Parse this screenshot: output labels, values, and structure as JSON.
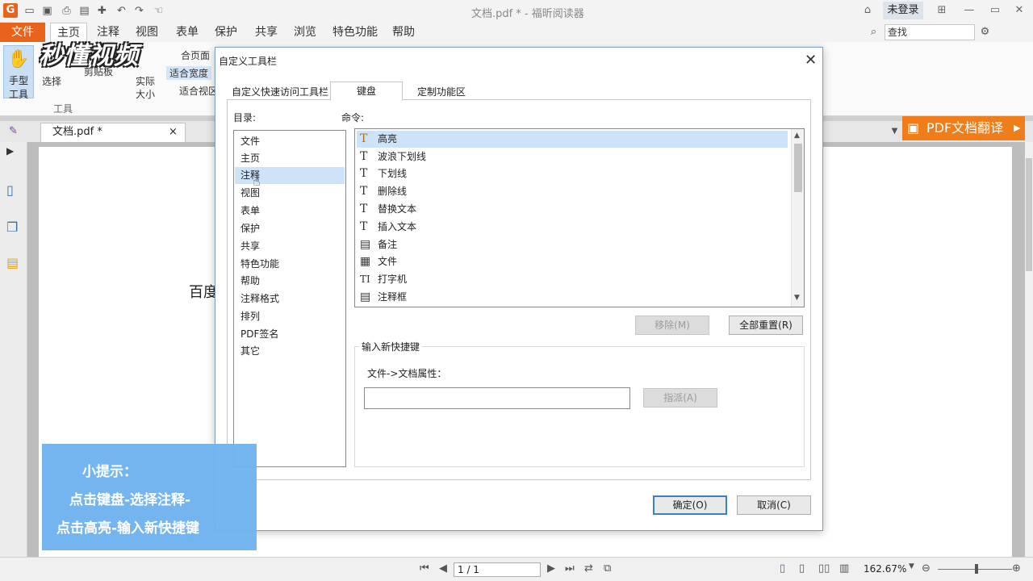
{
  "window": {
    "title": "文档.pdf * - 福昕阅读器",
    "login": "未登录"
  },
  "ribbon_tabs": [
    "文件",
    "主页",
    "注释",
    "视图",
    "表单",
    "保护",
    "共享",
    "浏览",
    "特色功能",
    "帮助"
  ],
  "search": {
    "placeholder": "查找"
  },
  "ribbon": {
    "hand_tool": "手型\n工具",
    "hand_tool_line1": "手型",
    "hand_tool_line2": "工具",
    "select": "选择",
    "clipboard": "剪贴板",
    "actual_size_1": "实际",
    "actual_size_2": "大小",
    "fit_page": "合页面",
    "fit_width": "适合宽度",
    "fit_view": "适合视区",
    "tools_group": "工具"
  },
  "doc_tab": {
    "label": "文档.pdf *",
    "close": "×"
  },
  "translate_button": "PDF文档翻译",
  "page": {
    "visible_text": "百度"
  },
  "statusbar": {
    "page_indicator": "1 / 1",
    "zoom": "162.67%"
  },
  "watermark": "秒懂视频",
  "dialog": {
    "title": "自定义工具栏",
    "close": "✕",
    "tabs": [
      "自定义快速访问工具栏",
      "键盘",
      "定制功能区"
    ],
    "directory_label": "目录:",
    "command_label": "命令:",
    "categories": [
      "文件",
      "主页",
      "注释",
      "视图",
      "表单",
      "保护",
      "共享",
      "特色功能",
      "帮助",
      "注释格式",
      "排列",
      "PDF签名",
      "其它"
    ],
    "selected_category": "注释",
    "commands": [
      {
        "label": "高亮",
        "icon": "T"
      },
      {
        "label": "波浪下划线",
        "icon": "T"
      },
      {
        "label": "下划线",
        "icon": "T"
      },
      {
        "label": "删除线",
        "icon": "T"
      },
      {
        "label": "替换文本",
        "icon": "T"
      },
      {
        "label": "插入文本",
        "icon": "T"
      },
      {
        "label": "备注",
        "icon": "▤"
      },
      {
        "label": "文件",
        "icon": "▦"
      },
      {
        "label": "打字机",
        "icon": "TI"
      },
      {
        "label": "注释框",
        "icon": "▤"
      }
    ],
    "remove_button": "移除(M)",
    "reset_all_button": "全部重置(R)",
    "new_shortcut_legend": "输入新快捷键",
    "path_label": "文件->文档属性：",
    "assign_button": "指派(A)",
    "ok_button": "确定(O)",
    "cancel_button": "取消(C)"
  },
  "tip": {
    "line1": "小提示：",
    "line2": "点击键盘-选择注释-",
    "line3": "点击高亮-输入新快捷键"
  }
}
